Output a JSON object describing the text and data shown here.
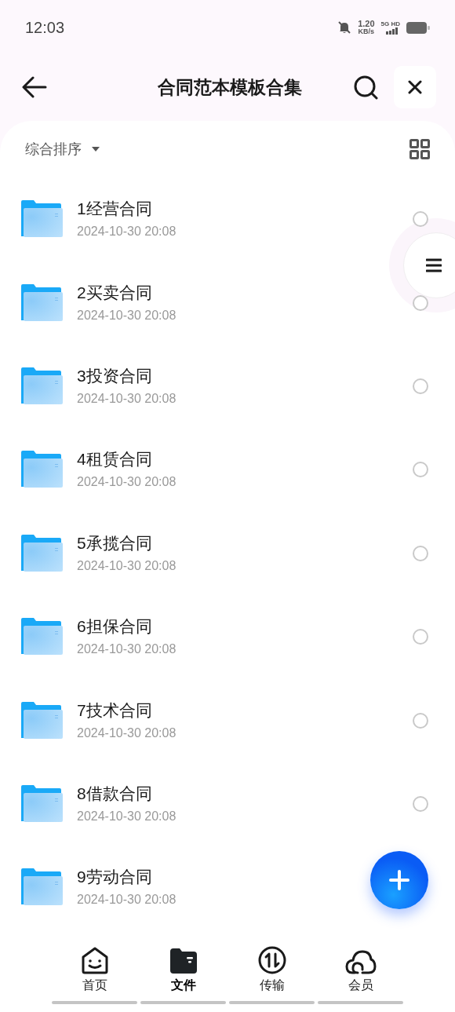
{
  "status_bar": {
    "time": "12:03",
    "speed_value": "1.20",
    "speed_unit": "KB/s",
    "network": "5G HD"
  },
  "header": {
    "title": "合同范本模板合集"
  },
  "sort": {
    "label": "综合排序"
  },
  "files": [
    {
      "name": "1经营合同",
      "date": "2024-10-30 20:08",
      "selected": false
    },
    {
      "name": "2买卖合同",
      "date": "2024-10-30 20:08",
      "selected": false
    },
    {
      "name": "3投资合同",
      "date": "2024-10-30 20:08",
      "selected": false
    },
    {
      "name": "4租赁合同",
      "date": "2024-10-30 20:08",
      "selected": false
    },
    {
      "name": "5承揽合同",
      "date": "2024-10-30 20:08",
      "selected": false
    },
    {
      "name": "6担保合同",
      "date": "2024-10-30 20:08",
      "selected": false
    },
    {
      "name": "7技术合同",
      "date": "2024-10-30 20:08",
      "selected": false
    },
    {
      "name": "8借款合同",
      "date": "2024-10-30 20:08",
      "selected": false
    },
    {
      "name": "9劳动合同",
      "date": "2024-10-30 20:08"
    }
  ],
  "nav": [
    {
      "kind": "home",
      "label": "首页",
      "selected": false
    },
    {
      "kind": "files",
      "label": "文件",
      "selected": true
    },
    {
      "kind": "transfer",
      "label": "传输",
      "selected": false
    },
    {
      "kind": "member",
      "label": "会员",
      "selected": false
    }
  ]
}
